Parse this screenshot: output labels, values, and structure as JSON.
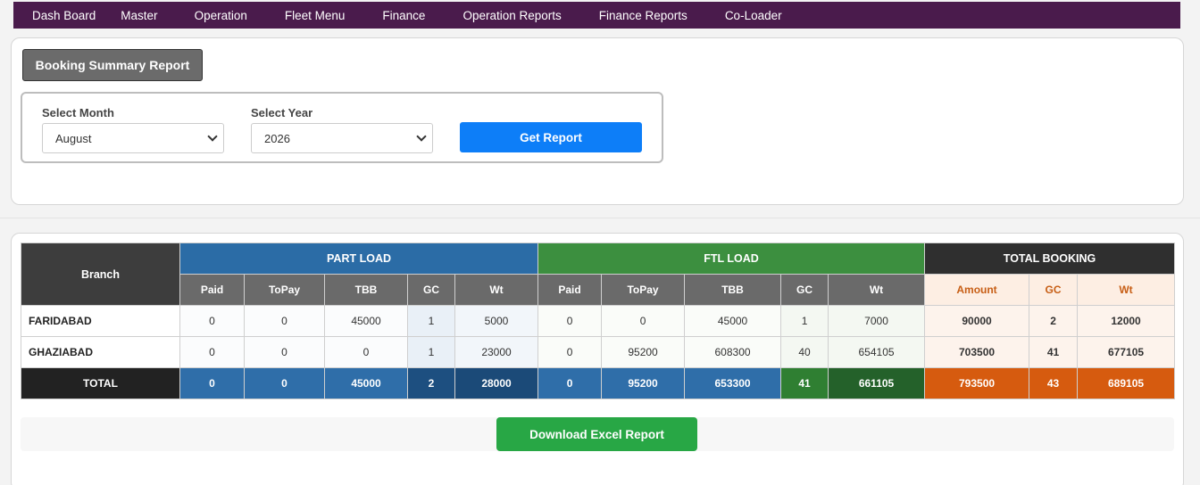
{
  "nav": {
    "items": [
      "Dash Board",
      "Master",
      "Operation",
      "Fleet Menu",
      "Finance",
      "Operation Reports",
      "Finance Reports",
      "Co-Loader"
    ]
  },
  "report_button": "Booking Summary Report",
  "filters": {
    "month_label": "Select Month",
    "month_value": "August",
    "year_label": "Select Year",
    "year_value": "2026",
    "get_report": "Get Report"
  },
  "table": {
    "branch_header": "Branch",
    "group_part": "PART LOAD",
    "group_ftl": "FTL LOAD",
    "group_total": "TOTAL BOOKING",
    "part_cols": [
      "Paid",
      "ToPay",
      "TBB",
      "GC",
      "Wt"
    ],
    "ftl_cols": [
      "Paid",
      "ToPay",
      "TBB",
      "GC",
      "Wt"
    ],
    "total_cols": [
      "Amount",
      "GC",
      "Wt"
    ],
    "rows": [
      {
        "branch": "FARIDABAD",
        "values": [
          "0",
          "0",
          "45000",
          "1",
          "5000",
          "0",
          "0",
          "45000",
          "1",
          "7000",
          "90000",
          "2",
          "12000"
        ]
      },
      {
        "branch": "GHAZIABAD",
        "values": [
          "0",
          "0",
          "0",
          "1",
          "23000",
          "0",
          "95200",
          "608300",
          "40",
          "654105",
          "703500",
          "41",
          "677105"
        ]
      }
    ],
    "total_row": {
      "branch": "TOTAL",
      "values": [
        "0",
        "0",
        "45000",
        "2",
        "28000",
        "0",
        "95200",
        "653300",
        "41",
        "661105",
        "793500",
        "43",
        "689105"
      ]
    }
  },
  "download_button": "Download Excel Report"
}
